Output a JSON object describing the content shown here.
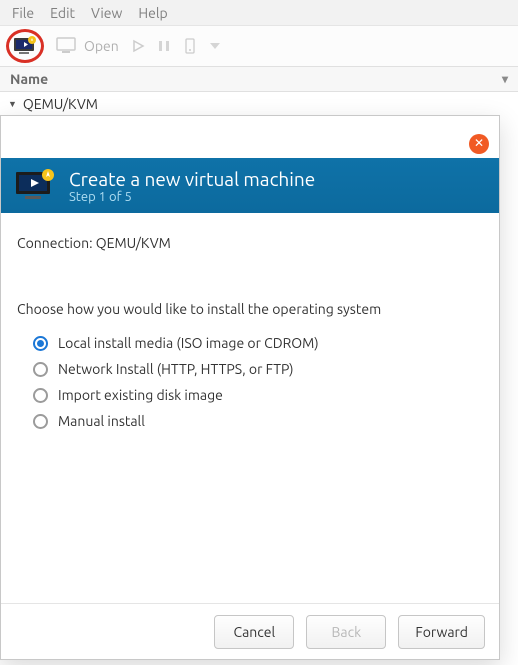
{
  "menubar": {
    "file": "File",
    "edit": "Edit",
    "view": "View",
    "help": "Help"
  },
  "toolbar": {
    "open_label": "Open"
  },
  "list": {
    "header": "Name",
    "connection": "QEMU/KVM"
  },
  "dialog": {
    "title": "Create a new virtual machine",
    "subtitle": "Step 1 of 5",
    "connection_label": "Connection:",
    "connection_value": "QEMU/KVM",
    "choose_line": "Choose how you would like to install the operating system",
    "options": [
      "Local install media (ISO image or CDROM)",
      "Network Install (HTTP, HTTPS, or FTP)",
      "Import existing disk image",
      "Manual install"
    ],
    "selected_index": 0,
    "buttons": {
      "cancel": "Cancel",
      "back": "Back",
      "forward": "Forward"
    }
  }
}
